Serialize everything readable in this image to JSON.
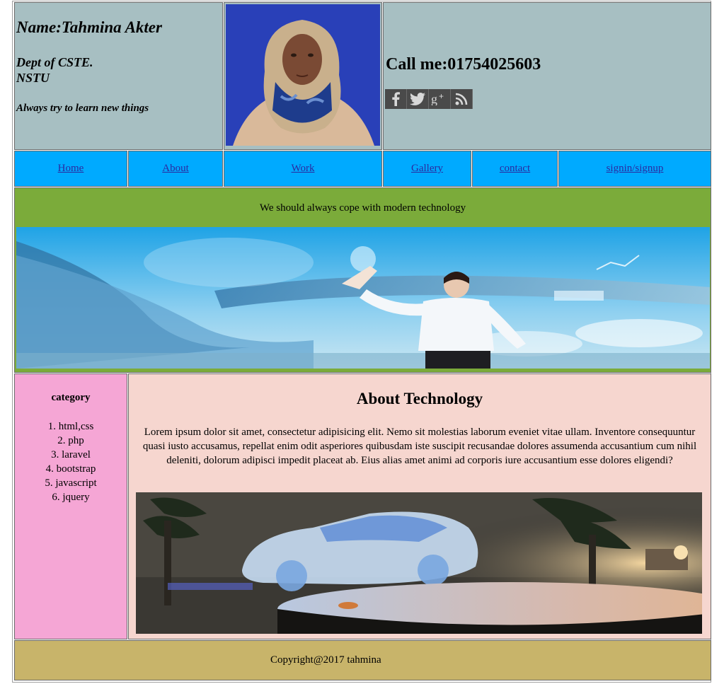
{
  "header": {
    "name": "Name:Tahmina Akter",
    "dept_line1": "Dept of CSTE.",
    "dept_line2": "NSTU",
    "motto": "Always try to learn new things",
    "phone": "Call me:01754025603",
    "social_icons": [
      "facebook-icon",
      "twitter-icon",
      "google-plus-icon",
      "rss-icon"
    ]
  },
  "nav": {
    "items": [
      "Home",
      "About",
      "Work",
      "Gallery",
      "contact",
      "signin/signup"
    ]
  },
  "banner": {
    "text": "We should always cope with modern technology"
  },
  "sidebar": {
    "title": "category",
    "items": [
      "1. html,css",
      "2. php",
      "3. laravel",
      "4. bootstrap",
      "5. javascript",
      "6. jquery"
    ]
  },
  "main": {
    "title": "About Technology",
    "body": "Lorem ipsum dolor sit amet, consectetur adipisicing elit. Nemo sit molestias laborum eveniet vitae ullam. Inventore consequuntur quasi iusto accusamus, repellat enim odit asperiores quibusdam iste suscipit recusandae dolores assumenda accusantium cum nihil deleniti, dolorum adipisci impedit placeat ab. Eius alias amet animi ad corporis iure accusantium esse dolores eligendi?"
  },
  "footer": {
    "text": "Copyright@2017 tahmina"
  },
  "colors": {
    "header_bg": "#a7bfc2",
    "nav_bg": "#00aaff",
    "banner_bg": "#7bab3a",
    "sidebar_bg": "#f5a6d5",
    "main_bg": "#f6d6cf",
    "footer_bg": "#c8b46a"
  }
}
